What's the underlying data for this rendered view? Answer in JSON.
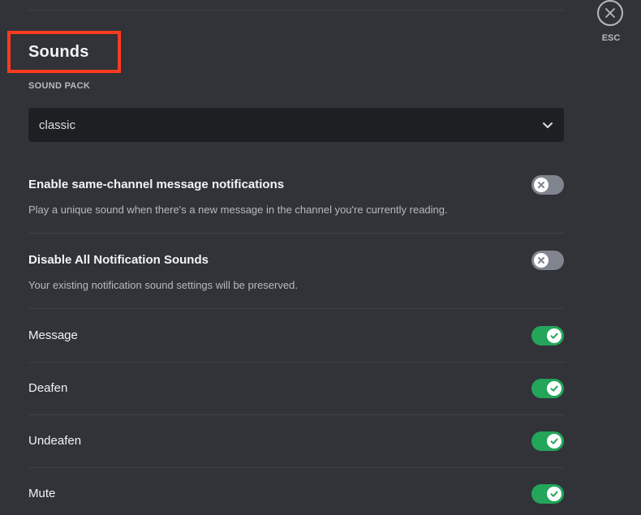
{
  "section": {
    "title": "Sounds"
  },
  "close": {
    "label": "ESC"
  },
  "sound_pack": {
    "label": "SOUND PACK",
    "value": "classic"
  },
  "settings": [
    {
      "title": "Enable same-channel message notifications",
      "description": "Play a unique sound when there's a new message in the channel you're currently reading.",
      "enabled": false
    },
    {
      "title": "Disable All Notification Sounds",
      "description": "Your existing notification sound settings will be preserved.",
      "enabled": false
    },
    {
      "title": "Message",
      "enabled": true
    },
    {
      "title": "Deafen",
      "enabled": true
    },
    {
      "title": "Undeafen",
      "enabled": true
    },
    {
      "title": "Mute",
      "enabled": true
    }
  ],
  "colors": {
    "background": "#313338",
    "toggle_on": "#23a55a",
    "toggle_off": "#80848e",
    "highlight": "#ff3b1f"
  }
}
